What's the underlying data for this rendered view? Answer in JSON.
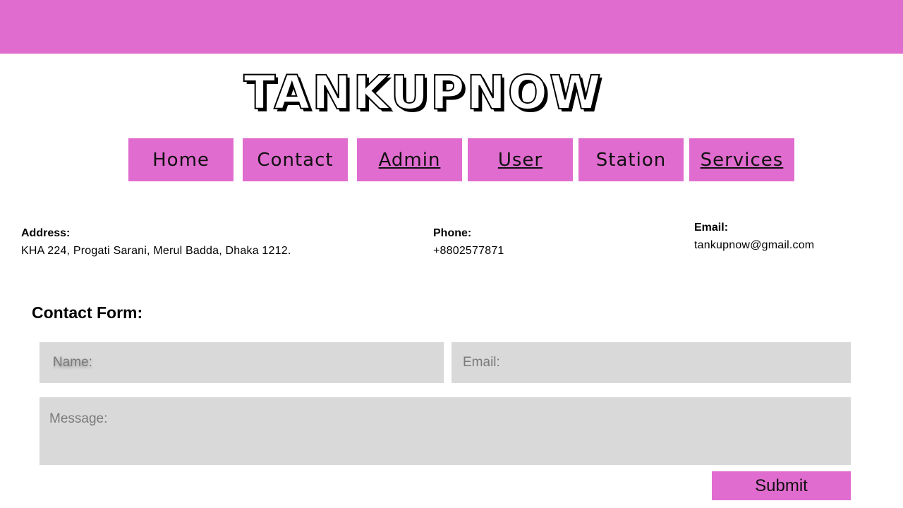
{
  "brand": {
    "logo_text": "TANKUPNOW"
  },
  "nav": {
    "items": [
      {
        "label": "Home"
      },
      {
        "label": "Contact"
      },
      {
        "label": "Admin"
      },
      {
        "label": "User"
      },
      {
        "label": "Station"
      },
      {
        "label": "Services"
      }
    ]
  },
  "contact_info": {
    "address_label": "Address:",
    "address_value": "KHA 224, Progati Sarani, Merul Badda, Dhaka 1212.",
    "phone_label": "Phone:",
    "phone_value": "+8802577871",
    "email_label": "Email:",
    "email_value": "tankupnow@gmail.com"
  },
  "form": {
    "title": "Contact Form:",
    "name_placeholder": "Name:",
    "email_placeholder": "Email:",
    "message_placeholder": "Message:",
    "submit_label": "Submit"
  },
  "colors": {
    "accent": "#e06ccf",
    "field_bg": "#d9d9d9"
  }
}
